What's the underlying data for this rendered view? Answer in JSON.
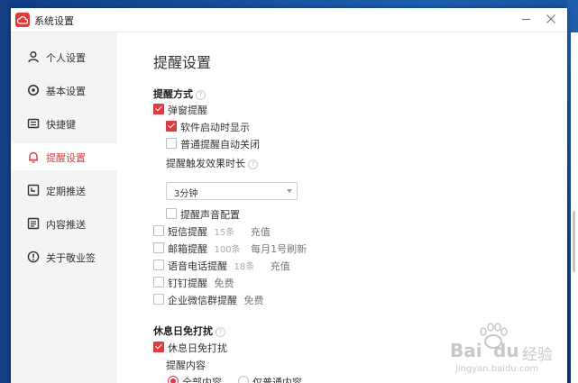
{
  "window": {
    "title": "系统设置"
  },
  "sidebar": {
    "items": [
      {
        "label": "个人设置",
        "icon": "person-icon",
        "active": false
      },
      {
        "label": "基本设置",
        "icon": "gear-icon",
        "active": false
      },
      {
        "label": "快捷键",
        "icon": "keyboard-icon",
        "active": false
      },
      {
        "label": "提醒设置",
        "icon": "bell-icon",
        "active": true
      },
      {
        "label": "定期推送",
        "icon": "calendar-clock-icon",
        "active": false
      },
      {
        "label": "内容推送",
        "icon": "document-icon",
        "active": false
      },
      {
        "label": "关于敬业签",
        "icon": "info-icon",
        "active": false
      }
    ]
  },
  "main": {
    "title": "提醒设置",
    "reminder_method": {
      "heading": "提醒方式",
      "popup": {
        "label": "弹窗提醒",
        "checked": true
      },
      "show_on_startup": {
        "label": "软件启动时显示",
        "checked": true
      },
      "auto_close_normal": {
        "label": "普通提醒自动关闭",
        "checked": false
      },
      "duration_label": "提醒触发效果时长",
      "duration_value": "3分钟",
      "sound_config": {
        "label": "提醒声音配置",
        "checked": false
      },
      "sms": {
        "label": "短信提醒",
        "meta": "15条",
        "action": "充值",
        "checked": false
      },
      "email": {
        "label": "邮箱提醒",
        "meta": "100条",
        "extra": "每月1号刷新",
        "checked": false
      },
      "voice": {
        "label": "语音电话提醒",
        "meta": "18条",
        "action": "充值",
        "checked": false
      },
      "dingtalk": {
        "label": "钉钉提醒",
        "extra": "免费",
        "checked": false
      },
      "wecom": {
        "label": "企业微信群提醒",
        "extra": "免费",
        "checked": false
      }
    },
    "rest_day": {
      "heading": "休息日免打扰",
      "enable": {
        "label": "休息日免打扰",
        "checked": true
      },
      "content_label": "提醒内容",
      "options": [
        {
          "label": "全部内容",
          "selected": true
        },
        {
          "label": "仅普通内容",
          "selected": false
        }
      ]
    }
  },
  "watermark": {
    "brand": "Bai",
    "brand_tail": "du",
    "cn": "经验",
    "url": "jingyan.baidu.com"
  },
  "colors": {
    "accent": "#e0393e",
    "sidebar_bg": "#f4f4f4"
  }
}
